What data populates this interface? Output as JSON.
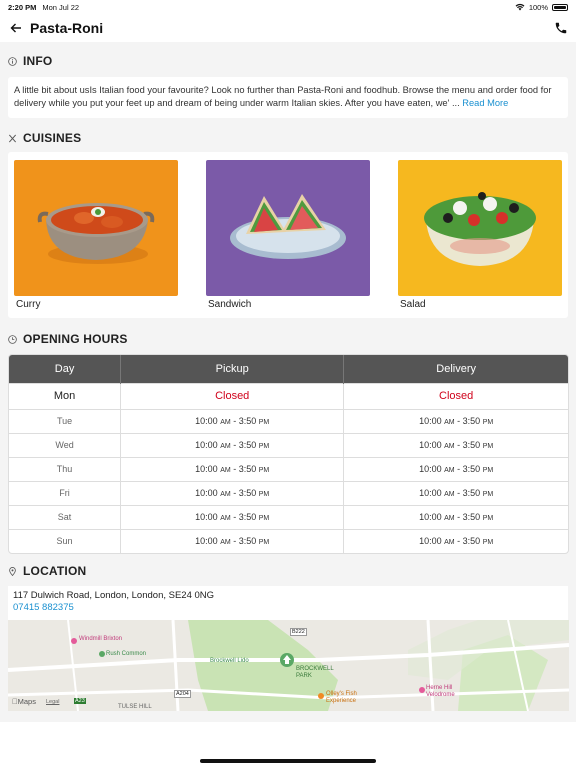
{
  "status": {
    "time": "2:20 PM",
    "date": "Mon Jul 22",
    "battery": "100%"
  },
  "nav": {
    "title": "Pasta-Roni",
    "back_icon": "arrow-left-icon",
    "phone_icon": "phone-icon"
  },
  "info": {
    "heading": "INFO",
    "text": "A little bit about usIs Italian food your favourite? Look no further than Pasta-Roni and foodhub. Browse the menu and order food for delivery while you put your feet up and dream of being under warm Italian skies. After you have eaten, we' ...",
    "read_more": "Read More"
  },
  "cuisines": {
    "heading": "CUISINES",
    "items": [
      {
        "label": "Curry",
        "bg": "#f0931b"
      },
      {
        "label": "Sandwich",
        "bg": "#7b5aa8"
      },
      {
        "label": "Salad",
        "bg": "#f6b81f"
      }
    ]
  },
  "hours": {
    "heading": "OPENING HOURS",
    "columns": [
      "Day",
      "Pickup",
      "Delivery"
    ],
    "rows": [
      {
        "day": "Mon",
        "pickup": "Closed",
        "delivery": "Closed"
      },
      {
        "day": "Tue",
        "p_open": "10:00",
        "p_open_ampm": "AM",
        "p_close": "3:50",
        "p_close_ampm": "PM",
        "d_open": "10:00",
        "d_open_ampm": "AM",
        "d_close": "3:50",
        "d_close_ampm": "PM"
      },
      {
        "day": "Wed",
        "p_open": "10:00",
        "p_open_ampm": "AM",
        "p_close": "3:50",
        "p_close_ampm": "PM",
        "d_open": "10:00",
        "d_open_ampm": "AM",
        "d_close": "3:50",
        "d_close_ampm": "PM"
      },
      {
        "day": "Thu",
        "p_open": "10:00",
        "p_open_ampm": "AM",
        "p_close": "3:50",
        "p_close_ampm": "PM",
        "d_open": "10:00",
        "d_open_ampm": "AM",
        "d_close": "3:50",
        "d_close_ampm": "PM"
      },
      {
        "day": "Fri",
        "p_open": "10:00",
        "p_open_ampm": "AM",
        "p_close": "3:50",
        "p_close_ampm": "PM",
        "d_open": "10:00",
        "d_open_ampm": "AM",
        "d_close": "3:50",
        "d_close_ampm": "PM"
      },
      {
        "day": "Sat",
        "p_open": "10:00",
        "p_open_ampm": "AM",
        "p_close": "3:50",
        "p_close_ampm": "PM",
        "d_open": "10:00",
        "d_open_ampm": "AM",
        "d_close": "3:50",
        "d_close_ampm": "PM"
      },
      {
        "day": "Sun",
        "p_open": "10:00",
        "p_open_ampm": "AM",
        "p_close": "3:50",
        "p_close_ampm": "PM",
        "d_open": "10:00",
        "d_open_ampm": "AM",
        "d_close": "3:50",
        "d_close_ampm": "PM"
      }
    ]
  },
  "location": {
    "heading": "LOCATION",
    "address": "117 Dulwich Road, London, London, SE24 0NG",
    "phone": "07415 882375",
    "map_labels": {
      "windmill": "Windmill Brixton",
      "rush_common": "Rush Common",
      "brockwell_lido": "Brockwell Lido",
      "brockwell_park": "BROCKWELL PARK",
      "olleys": "Olley's Fish Experience",
      "herne_hill": "Herne Hill Velodrome",
      "b222": "B222",
      "a204": "A204",
      "a23": "A23",
      "tulse_hill": "TULSE HILL",
      "maps_brand": "Maps",
      "legal": "Legal"
    }
  },
  "colors": {
    "accent": "#1a90d0",
    "closed": "#d0021b",
    "table_header": "#555555"
  }
}
